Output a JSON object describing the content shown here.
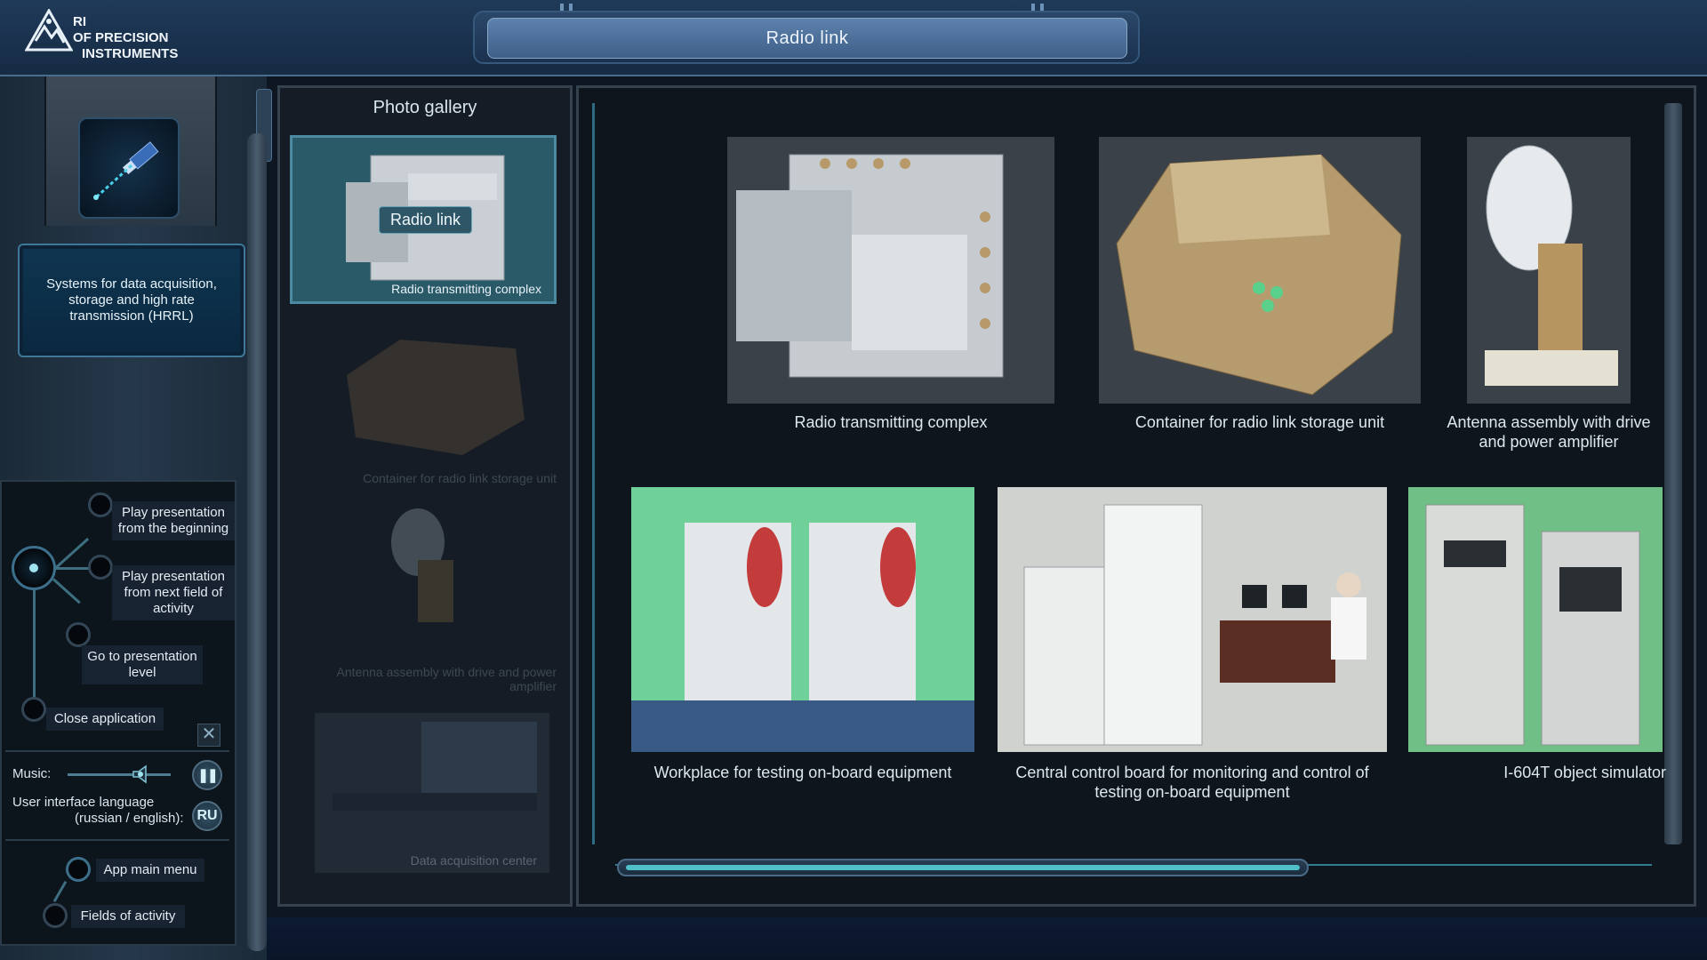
{
  "header": {
    "logo_lines": [
      "RI",
      "OF PRECISION",
      "INSTRUMENTS"
    ],
    "title": "Radio link"
  },
  "field_of_activity": {
    "label": "Systems for data acquisition, storage and high rate transmission (HRRL)"
  },
  "menu": {
    "play_beginning": "Play presentation from the beginning",
    "play_next": "Play presentation from next field of activity",
    "go_level": "Go to presentation level",
    "close_app": "Close application",
    "music_label": "Music:",
    "lang_label_1": "User interface language",
    "lang_label_2": "(russian / english):",
    "lang_value": "RU",
    "main_menu": "App main menu",
    "fields": "Fields of activity"
  },
  "gallery": {
    "title": "Photo gallery",
    "active_badge": "Radio link",
    "thumbs": [
      "Radio transmitting complex",
      "Container for radio link storage unit",
      "Antenna assembly with drive and power amplifier",
      "Data acquisition center"
    ]
  },
  "viewer": {
    "photos": [
      "Radio transmitting complex",
      "Container for radio link storage unit",
      "Antenna assembly with drive and power amplifier",
      "Workplace for testing on-board equipment",
      "Central control board for monitoring and control of testing on-board equipment",
      "I-604T object simulator"
    ]
  },
  "colors": {
    "accent": "#50c0c8",
    "panel": "#151c25"
  }
}
